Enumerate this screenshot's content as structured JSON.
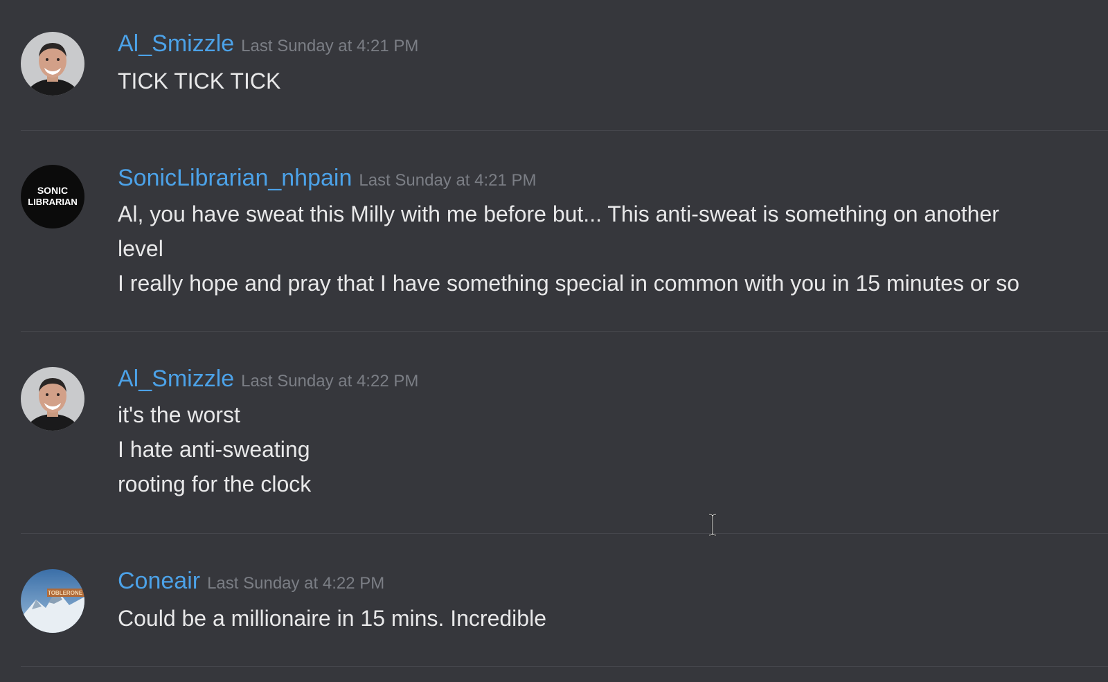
{
  "messages": [
    {
      "author": "Al_Smizzle",
      "timestamp": "Last Sunday at 4:21 PM",
      "avatar_icon": "smiling-man-avatar",
      "lines": [
        "TICK TICK TICK"
      ]
    },
    {
      "author": "SonicLibrarian_nhpain",
      "timestamp": "Last Sunday at 4:21 PM",
      "avatar_icon": "sonic-librarian-logo-avatar",
      "avatar_text": [
        "SONIC",
        "LIBRARIAN"
      ],
      "lines": [
        "Al, you have sweat this Milly with me before but... This anti-sweat is something on another",
        "level",
        "I really hope and pray that I have something special in common with you in 15 minutes or so"
      ]
    },
    {
      "author": "Al_Smizzle",
      "timestamp": "Last Sunday at 4:22 PM",
      "avatar_icon": "smiling-man-avatar",
      "lines": [
        "it's the worst",
        "I hate anti-sweating",
        "rooting for the clock"
      ]
    },
    {
      "author": "Coneair",
      "timestamp": "Last Sunday at 4:22 PM",
      "avatar_icon": "mountain-toblerone-avatar",
      "avatar_text": [
        "TOBLERONE"
      ],
      "lines": [
        "Could be a millionaire in 15 mins. Incredible"
      ]
    }
  ],
  "colors": {
    "background": "#36373c",
    "username": "#4ca2e8",
    "timestamp": "#7b7e85",
    "message_text": "#e8e8e9",
    "divider": "#45464c"
  }
}
